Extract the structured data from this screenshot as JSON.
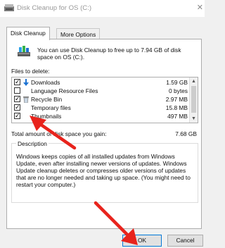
{
  "window": {
    "title": "Disk Cleanup for OS (C:)"
  },
  "tabs": [
    {
      "label": "Disk Cleanup",
      "active": true
    },
    {
      "label": "More Options",
      "active": false
    }
  ],
  "intro_text": "You can use Disk Cleanup to free up to 7.94 GB of disk space on OS (C:).",
  "files_label": "Files to delete:",
  "files": [
    {
      "name": "Downloads",
      "size": "1.59 GB",
      "checked": true,
      "icon": "download-icon"
    },
    {
      "name": "Language Resource Files",
      "size": "0 bytes",
      "checked": false,
      "icon": "none"
    },
    {
      "name": "Recycle Bin",
      "size": "2.97 MB",
      "checked": true,
      "icon": "recycle-bin-icon"
    },
    {
      "name": "Temporary files",
      "size": "15.8 MB",
      "checked": true,
      "icon": "none"
    },
    {
      "name": "Thumbnails",
      "size": "497 MB",
      "checked": true,
      "icon": "none"
    }
  ],
  "total": {
    "label": "Total amount of disk space you gain:",
    "value": "7.68 GB"
  },
  "description": {
    "legend": "Description",
    "text": "Windows keeps copies of all installed updates from Windows Update, even after installing newer versions of updates. Windows Update cleanup deletes or compresses older versions of updates that are no longer needed and taking up space. (You might need to restart your computer.)"
  },
  "buttons": {
    "ok": "OK",
    "cancel": "Cancel"
  },
  "colors": {
    "annotation_arrow": "#e8231c",
    "download_blue": "#1e73d2",
    "ok_border": "#0078d7"
  }
}
